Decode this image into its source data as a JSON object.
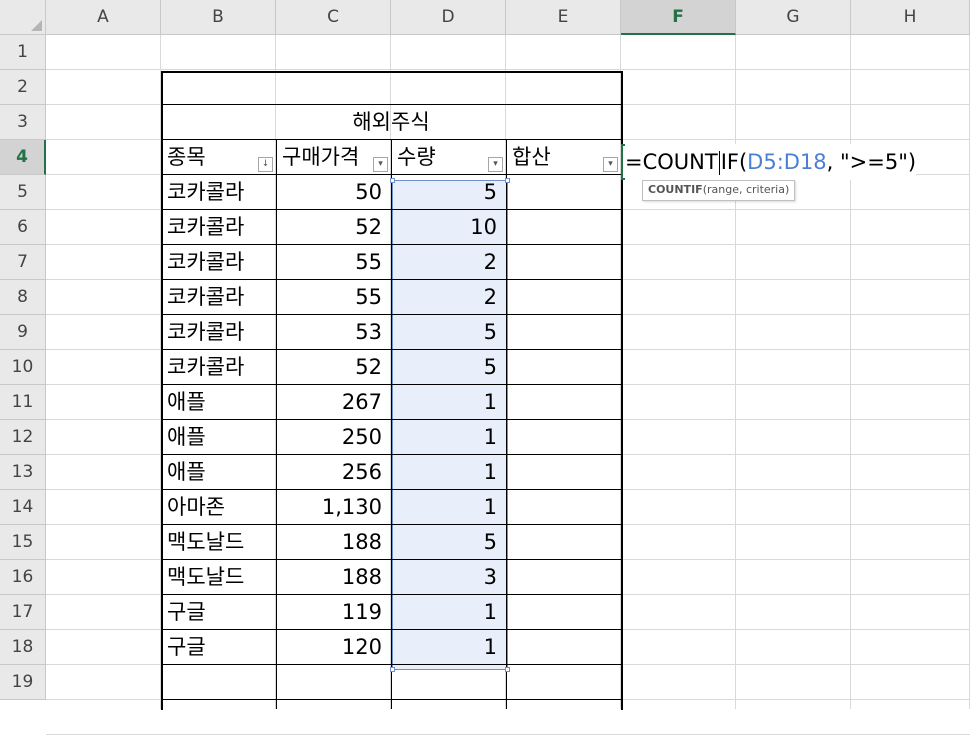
{
  "columns": [
    "A",
    "B",
    "C",
    "D",
    "E",
    "F",
    "G",
    "H"
  ],
  "rows": [
    "1",
    "2",
    "3",
    "4",
    "5",
    "6",
    "7",
    "8",
    "9",
    "10",
    "11",
    "12",
    "13",
    "14",
    "15",
    "16",
    "17",
    "18",
    "19"
  ],
  "selected_column": "F",
  "selected_row": "4",
  "table": {
    "title": "해외주식",
    "headers": [
      "종목",
      "구매가격",
      "수량",
      "합산"
    ],
    "data": [
      [
        "코카콜라",
        "50",
        "5"
      ],
      [
        "코카콜라",
        "52",
        "10"
      ],
      [
        "코카콜라",
        "55",
        "2"
      ],
      [
        "코카콜라",
        "55",
        "2"
      ],
      [
        "코카콜라",
        "53",
        "5"
      ],
      [
        "코카콜라",
        "52",
        "5"
      ],
      [
        "애플",
        "267",
        "1"
      ],
      [
        "애플",
        "250",
        "1"
      ],
      [
        "애플",
        "256",
        "1"
      ],
      [
        "아마존",
        "1,130",
        "1"
      ],
      [
        "맥도날드",
        "188",
        "5"
      ],
      [
        "맥도날드",
        "188",
        "3"
      ],
      [
        "구글",
        "119",
        "1"
      ],
      [
        "구글",
        "120",
        "1"
      ]
    ]
  },
  "formula": {
    "prefix": "=COUNT",
    "suffix": "IF(",
    "range_ref": "D5:D18",
    "rest": ", \">=5\")"
  },
  "tooltip": {
    "fn": "COUNTIF",
    "args": "(range, criteria)"
  },
  "colors": {
    "accent": "#217346",
    "range_ref": "#4a7fd3",
    "selection_fill": "#e8eefa"
  }
}
